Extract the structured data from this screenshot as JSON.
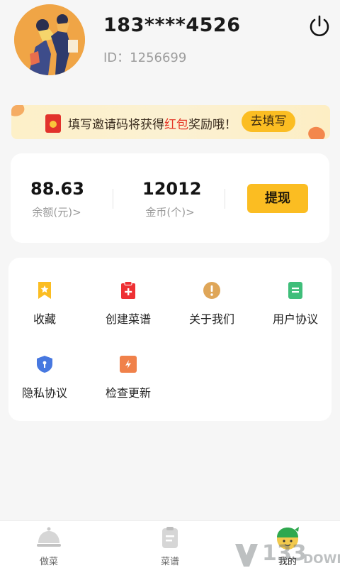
{
  "profile": {
    "phone": "183****4526",
    "id_label": "ID：1256699"
  },
  "invite_banner": {
    "text_before": "填写邀请码将获得",
    "text_highlight": "红包",
    "text_after": "奖励哦！",
    "button_label": "去填写"
  },
  "wallet": {
    "balance_value": "88.63",
    "balance_label": "余额(元)>",
    "coins_value": "12012",
    "coins_label": "金币(个)>",
    "withdraw_label": "提现"
  },
  "menu": {
    "items": [
      {
        "label": "收藏",
        "icon": "bookmark-icon",
        "color": "#fbbd22"
      },
      {
        "label": "创建菜谱",
        "icon": "clipboard-plus-icon",
        "color": "#ee3034"
      },
      {
        "label": "关于我们",
        "icon": "info-icon",
        "color": "#dfa658"
      },
      {
        "label": "用户协议",
        "icon": "document-icon",
        "color": "#3fbe7a"
      },
      {
        "label": "隐私协议",
        "icon": "shield-icon",
        "color": "#4778e0"
      },
      {
        "label": "检查更新",
        "icon": "refresh-icon",
        "color": "#f0814a"
      }
    ]
  },
  "bottom_nav": {
    "items": [
      {
        "label": "做菜",
        "icon": "cloche-icon"
      },
      {
        "label": "菜谱",
        "icon": "recipe-icon"
      },
      {
        "label": "我的",
        "icon": "profile-mascot-icon",
        "active": true
      }
    ]
  },
  "watermark": {
    "number": "133",
    "text": "DOWN"
  },
  "colors": {
    "accent": "#fbbd22",
    "highlight_red": "#e53626",
    "background": "#f6f6f6"
  }
}
